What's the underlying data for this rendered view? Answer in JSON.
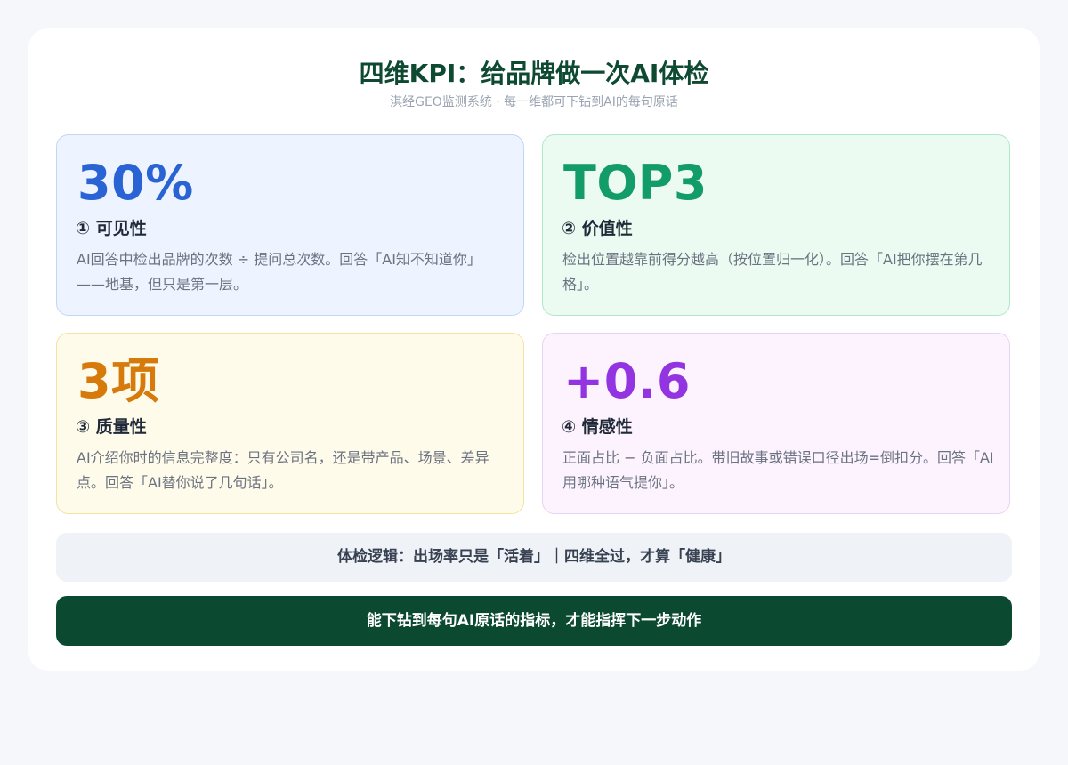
{
  "header": {
    "title": "四维KPI：给品牌做一次AI体检",
    "subtitle": "淇经GEO监测系统 · 每一维都可下钻到AI的每句原话"
  },
  "cards": [
    {
      "metric": "30%",
      "label": "① 可见性",
      "description": "AI回答中检出品牌的次数 ÷ 提问总次数。回答「AI知不知道你」——地基，但只是第一层。",
      "accent_color": "#2a63d4"
    },
    {
      "metric": "TOP3",
      "label": "② 价值性",
      "description": "检出位置越靠前得分越高（按位置归一化）。回答「AI把你摆在第几格」。",
      "accent_color": "#129c67"
    },
    {
      "metric": "3项",
      "label": "③ 质量性",
      "description": "AI介绍你时的信息完整度：只有公司名，还是带产品、场景、差异点。回答「AI替你说了几句话」。",
      "accent_color": "#d67a0c"
    },
    {
      "metric": "+0.6",
      "label": "④ 情感性",
      "description": "正面占比 − 负面占比。带旧故事或错误口径出场=倒扣分。回答「AI用哪种语气提你」。",
      "accent_color": "#9234e0"
    }
  ],
  "footer": {
    "logic": "体检逻辑：出场率只是「活着」｜四维全过，才算「健康」",
    "action": "能下钻到每句AI原话的指标，才能指挥下一步动作"
  },
  "colors": {
    "brand_dark_green": "#0b4a30",
    "page_background": "#f5f7fa"
  }
}
